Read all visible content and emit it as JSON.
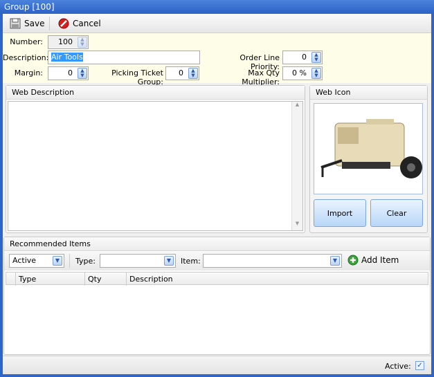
{
  "window": {
    "title": "Group [100]"
  },
  "toolbar": {
    "save_label": "Save",
    "cancel_label": "Cancel"
  },
  "form": {
    "number_label": "Number:",
    "number_value": "100",
    "description_label": "Description:",
    "description_value": "Air Tools",
    "margin_label": "Margin:",
    "margin_value": "0",
    "picking_label": "Picking Ticket Group:",
    "picking_value": "0",
    "order_priority_label": "Order Line Priority:",
    "order_priority_value": "0",
    "max_qty_label": "Max Qty Multiplier:",
    "max_qty_value": "0 %"
  },
  "web_description": {
    "title": "Web Description",
    "value": ""
  },
  "web_icon": {
    "title": "Web Icon",
    "import_label": "Import",
    "clear_label": "Clear"
  },
  "recommended": {
    "title": "Recommended Items",
    "status_value": "Active",
    "type_label": "Type:",
    "type_value": "",
    "item_label": "Item:",
    "item_value": "",
    "add_label": "Add Item",
    "columns": [
      "Type",
      "Qty",
      "Description"
    ],
    "rows": []
  },
  "footer": {
    "active_label": "Active:",
    "active_checked": true
  },
  "colors": {
    "title_bar": "#2d62c6",
    "form_bg": "#fdfde8",
    "selection": "#3399ff"
  }
}
